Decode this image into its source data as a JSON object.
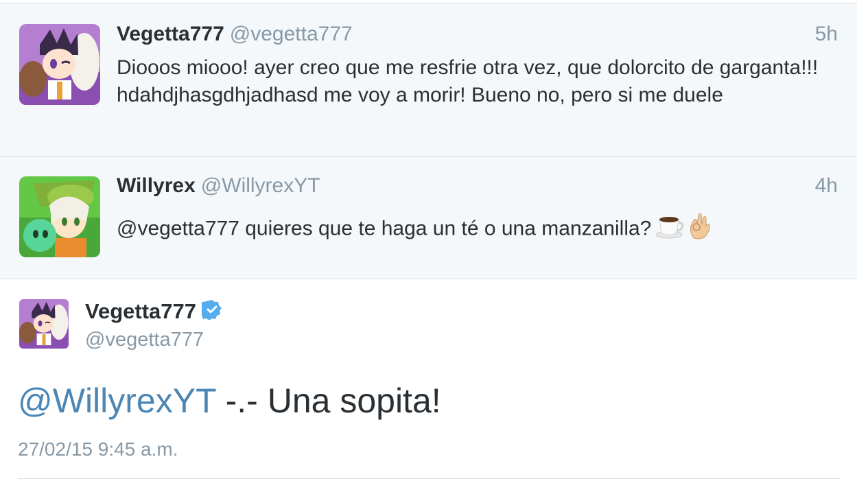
{
  "replies": [
    {
      "name": "Vegetta777",
      "handle": "@vegetta777",
      "time": "5h",
      "text": "Diooos miooo! ayer creo que me resfrie otra vez, que dolorcito de garganta!!! hdahdjhasgdhjadhasd me voy a morir! Bueno no, pero si me duele"
    },
    {
      "name": "Willyrex",
      "handle": "@WillyrexYT",
      "time": "4h",
      "text": "@vegetta777 quieres que te haga un té o una manzanilla?",
      "emojis": [
        "coffee-cup-icon",
        "ok-hand-icon"
      ]
    }
  ],
  "main_tweet": {
    "name": "Vegetta777",
    "verified": true,
    "handle": "@vegetta777",
    "mention": "@WillyrexYT",
    "text": " -.- Una sopita!",
    "timestamp": "27/02/15 9:45 a.m."
  },
  "colors": {
    "link": "#4b86b4",
    "muted": "#8899a6",
    "verified": "#55acee",
    "reply_bg": "#f5f8fa"
  }
}
